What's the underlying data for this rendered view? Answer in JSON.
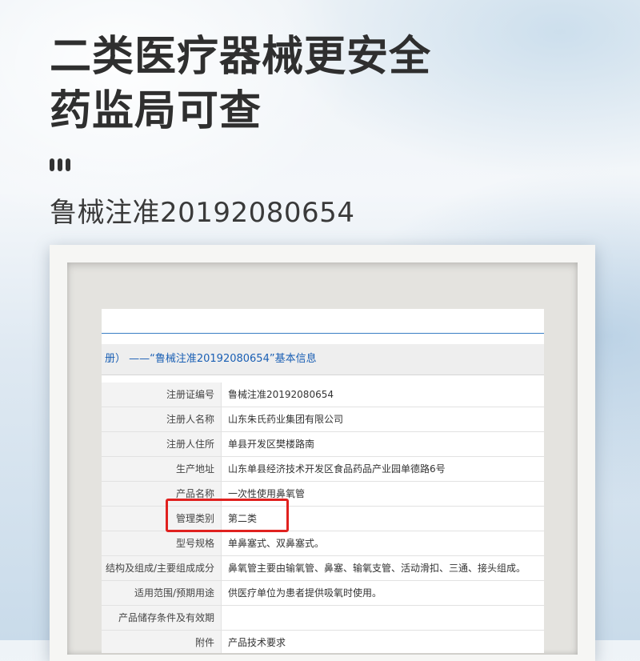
{
  "headline": {
    "line1": "二类医疗器械更安全",
    "line2": "药监局可查"
  },
  "registration_line": "鲁械注准20192080654",
  "document": {
    "header": "册） ——“鲁械注准20192080654”基本信息",
    "rows": [
      {
        "label": "注册证编号",
        "value": "鲁械注准20192080654"
      },
      {
        "label": "注册人名称",
        "value": "山东朱氏药业集团有限公司"
      },
      {
        "label": "注册人住所",
        "value": "单县开发区樊楼路南"
      },
      {
        "label": "生产地址",
        "value": "山东单县经济技术开发区食品药品产业园单德路6号"
      },
      {
        "label": "产品名称",
        "value": "一次性使用鼻氧管"
      },
      {
        "label": "管理类别",
        "value": "第二类"
      },
      {
        "label": "型号规格",
        "value": "单鼻塞式、双鼻塞式。"
      },
      {
        "label": "结构及组成/主要组成成分",
        "value": "鼻氧管主要由输氧管、鼻塞、输氧支管、活动滑扣、三通、接头组成。"
      },
      {
        "label": "适用范围/预期用途",
        "value": "供医疗单位为患者提供吸氧时使用。"
      },
      {
        "label": "产品储存条件及有效期",
        "value": ""
      },
      {
        "label": "附件",
        "value": "产品技术要求"
      }
    ]
  },
  "colors": {
    "headline": "#2f2f2f",
    "link_blue": "#1a5fb4",
    "highlight_red": "#e0211f"
  }
}
